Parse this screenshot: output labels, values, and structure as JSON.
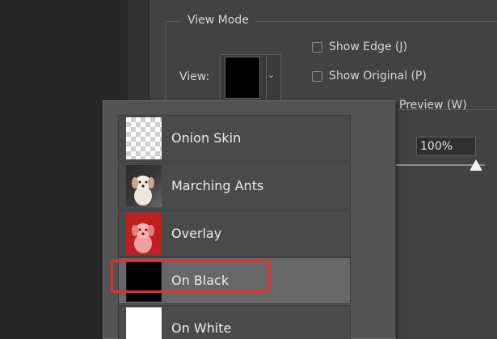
{
  "view_mode": {
    "title": "View Mode",
    "view_label": "View:",
    "current_view": "On Black",
    "show_edge_label": "Show Edge (J)",
    "show_original_label": "Show Original (P)",
    "preview_label": "Preview (W)"
  },
  "opacity": {
    "value": "100%",
    "slider_fraction": 1.0
  },
  "dropdown": {
    "items": [
      {
        "label": "Onion Skin",
        "thumb": "checkerboard-thumbnail"
      },
      {
        "label": "Marching Ants",
        "thumb": "dog-photo-thumbnail"
      },
      {
        "label": "Overlay",
        "thumb": "dog-red-overlay-thumbnail"
      },
      {
        "label": "On Black",
        "thumb": "black-swatch-thumbnail",
        "selected": true
      },
      {
        "label": "On White",
        "thumb": "white-swatch-thumbnail"
      }
    ]
  },
  "colors": {
    "highlight": "#e52e2e",
    "selected_row": "#676767",
    "overlay_red": "#c01f1f"
  }
}
